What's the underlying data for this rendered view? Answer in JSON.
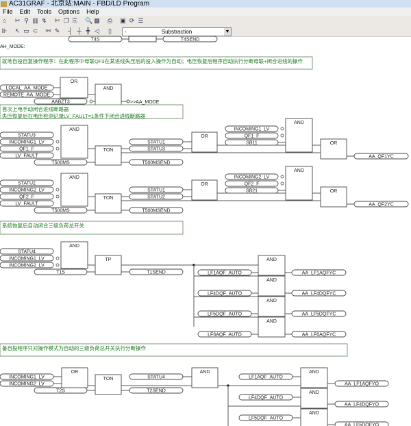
{
  "window": {
    "title": "AC31GRAF - 北京站:MAIN - FBD/LD Program"
  },
  "menu": [
    "File",
    "Edit",
    "Tools",
    "Options",
    "Help"
  ],
  "toolbar": {
    "operation_select": "Substraction",
    "operation_prefix": "-"
  },
  "icons": [
    "home-icon",
    "cut-icon",
    "find-icon",
    "chart-icon",
    "connect-icon",
    "scissors-icon",
    "copy-icon",
    "paste-icon",
    "search-icon",
    "grid-icon",
    "print-icon",
    "window-icon",
    "refresh-icon",
    "list-icon"
  ],
  "section_label": "AH_MODE:",
  "comments": [
    "就地自投自复操作程序：在此程序中母联QF3在某进线失压后的投入操作为自动；电压恢复后程序自动执行分断母联+闭合进线的操作",
    "首次上电手动闭合进线断路器",
    "失压恢复后在电压检测记录LV_FAULT=1条件下闭合进线断路器",
    "系统恢复后自动闭合三级负荷总开关",
    "备自投程序只对操作模式为自动的三级负荷总开关执行分断操作"
  ],
  "blocks": [
    "OR",
    "AND",
    "AND",
    "TON",
    "OR",
    "AND",
    "OR",
    "AND",
    "TON",
    "OR",
    "AND",
    "OR",
    "AND",
    "TP",
    "AND",
    "AND",
    "AND",
    "AND",
    "OR",
    "TON",
    "AND",
    "AND",
    "AND",
    "AND"
  ],
  "variables": [
    "T4S",
    "T4SEND",
    "LOCAL_AA_MODE",
    "REMOTE_AA_MODE",
    "AABZT3",
    "AA_MODE",
    "STATU3",
    "INCOMING1_LV",
    "QF1_F",
    "LV_FAULT",
    "T500MS",
    "STATU1",
    "STATU3",
    "T500MSEND",
    "INCOMING1_LV",
    "QF1_F",
    "SB11",
    "AA_QF1YC",
    "STATU2",
    "INCOMING2_LV",
    "QF2_F",
    "LV_FAULT",
    "T500MS",
    "STATU1",
    "STATU2",
    "T500MSEND",
    "INCOMING2_LV",
    "QF2_F",
    "SB21",
    "AA_QF2YC",
    "STATU4",
    "INCOMING1_LV",
    "INCOMING2_LV",
    "T1S",
    "T1SEND",
    "LF1AQF_AUTO",
    "LF4DQF_AUTO",
    "LF5DQF_AUTO",
    "LF6AQF_AUTO",
    "AA_LF1AQFYC",
    "AA_LF4DQFYC",
    "AA_LF5DQFYC",
    "AA_LF6AQFYC",
    "INCOMING1_LV",
    "INCOMING2_LV",
    "T2S",
    "STATU4",
    "T2SEND",
    "LF1AQF_AUTO",
    "LF4DQF_AUTO",
    "LF5DQF_AUTO",
    "AA_LF1AQFYO",
    "AA_LF4DQFYO",
    "AA_LF5DQFYO"
  ]
}
